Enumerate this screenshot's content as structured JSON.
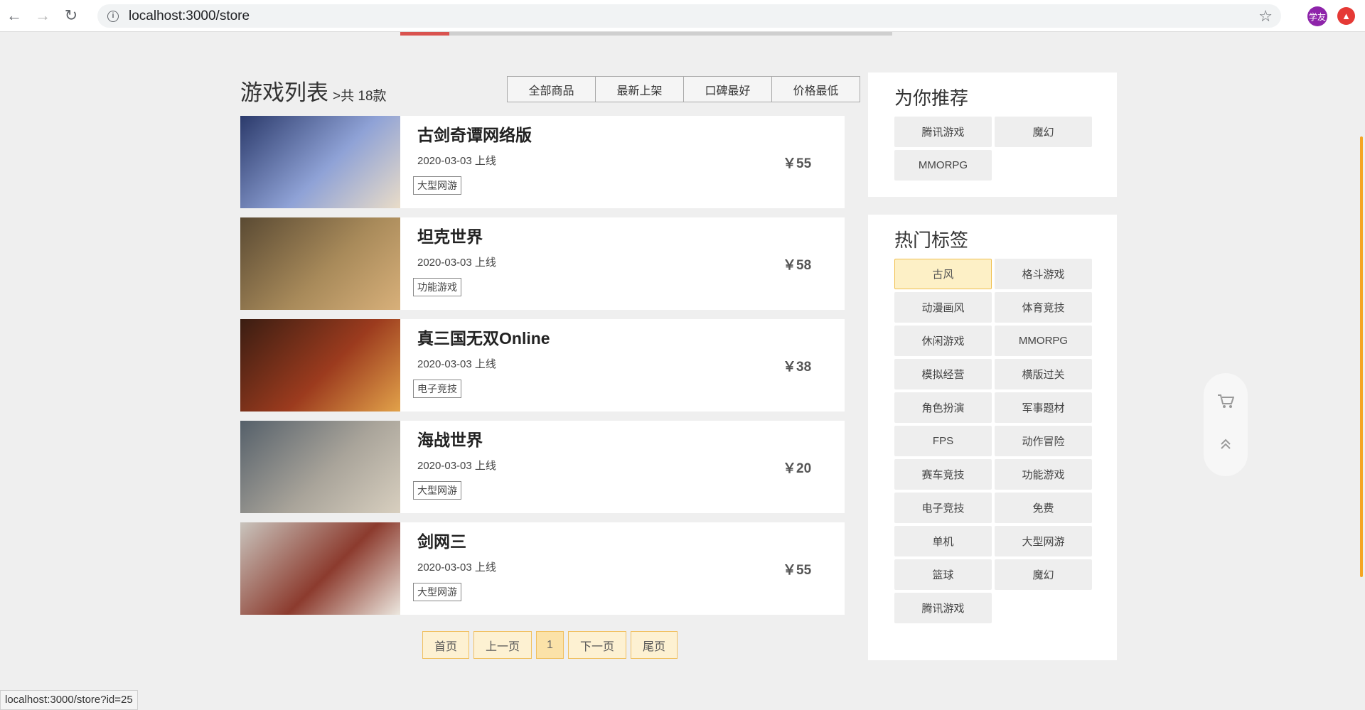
{
  "browser": {
    "url": "localhost:3000/store",
    "profile_label": "学友",
    "status_url": "localhost:3000/store?id=25"
  },
  "top_progress": {
    "fraction": 0.1
  },
  "list": {
    "title": "游戏列表",
    "count": ">共 18款"
  },
  "sort_tabs": [
    "全部商品",
    "最新上架",
    "口碑最好",
    "价格最低"
  ],
  "games": [
    {
      "name": "古剑奇谭网络版",
      "date": "2020-03-03 上线",
      "tag": "大型网游",
      "price": "￥55",
      "thumb_colors": [
        "#2b3a6b",
        "#8fa2d6",
        "#e9dcc8"
      ]
    },
    {
      "name": "坦克世界",
      "date": "2020-03-03 上线",
      "tag": "功能游戏",
      "price": "￥58",
      "thumb_colors": [
        "#5a4a33",
        "#a88a5a",
        "#d8b07a"
      ]
    },
    {
      "name": "真三国无双Online",
      "date": "2020-03-03 上线",
      "tag": "电子竞技",
      "price": "￥38",
      "thumb_colors": [
        "#3a1d12",
        "#9c3b1e",
        "#e2a24a"
      ]
    },
    {
      "name": "海战世界",
      "date": "2020-03-03 上线",
      "tag": "大型网游",
      "price": "￥20",
      "thumb_colors": [
        "#55606a",
        "#a9a49a",
        "#d8cfbf"
      ]
    },
    {
      "name": "剑网三",
      "date": "2020-03-03 上线",
      "tag": "大型网游",
      "price": "￥55",
      "thumb_colors": [
        "#c9c4bd",
        "#8c3b2e",
        "#ece7df"
      ]
    }
  ],
  "pager": {
    "first": "首页",
    "prev": "上一页",
    "current": "1",
    "next": "下一页",
    "last": "尾页"
  },
  "recommend": {
    "title": "为你推荐",
    "tags": [
      "腾讯游戏",
      "魔幻",
      "MMORPG"
    ]
  },
  "hot_tags": {
    "title": "热门标签",
    "tags": [
      "古风",
      "格斗游戏",
      "动漫画风",
      "体育竞技",
      "休闲游戏",
      "MMORPG",
      "模拟经营",
      "横版过关",
      "角色扮演",
      "军事题材",
      "FPS",
      "动作冒险",
      "赛车竞技",
      "功能游戏",
      "电子竞技",
      "免费",
      "单机",
      "大型网游",
      "篮球",
      "魔幻",
      "腾讯游戏"
    ],
    "active_index": 0
  },
  "icons": {
    "back": "back-arrow-icon",
    "forward": "forward-arrow-icon",
    "reload": "reload-icon",
    "info": "info-icon",
    "star": "star-icon",
    "extension": "extension-icon",
    "cart": "cart-icon",
    "scroll_top": "scroll-top-icon"
  },
  "colors": {
    "accent": "#f0c050",
    "progress": "#d9534f",
    "scroll_indicator": "#f5a623"
  }
}
